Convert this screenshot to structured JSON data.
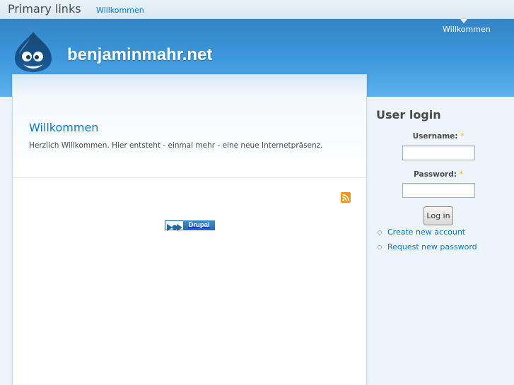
{
  "primary_links": {
    "title": "Primary links",
    "items": [
      {
        "label": "Willkommen"
      }
    ]
  },
  "header": {
    "secondary_link": "Willkommen",
    "site_name": "benjaminmahr.net"
  },
  "node": {
    "title": "Willkommen",
    "body": "Herzlich Willkommen. Hier entsteht - einmal mehr - eine neue Internetpräsenz."
  },
  "footer": {
    "badge_text": "Drupal"
  },
  "user_login": {
    "title": "User login",
    "username_label": "Username:",
    "password_label": "Password:",
    "required_marker": "*",
    "login_button": "Log in",
    "links": [
      {
        "label": "Create new account"
      },
      {
        "label": "Request new password"
      }
    ]
  },
  "colors": {
    "link": "#027ac6",
    "header_dark": "#1d77c0",
    "header_light": "#5db2ee",
    "page_background": "#edf5fa",
    "feed": "#f7921e",
    "required": "#ffae00"
  },
  "icons": {
    "logo": "drupal-drop-icon",
    "feed": "rss-feed-icon",
    "bullet": "circle-bullet-icon"
  }
}
